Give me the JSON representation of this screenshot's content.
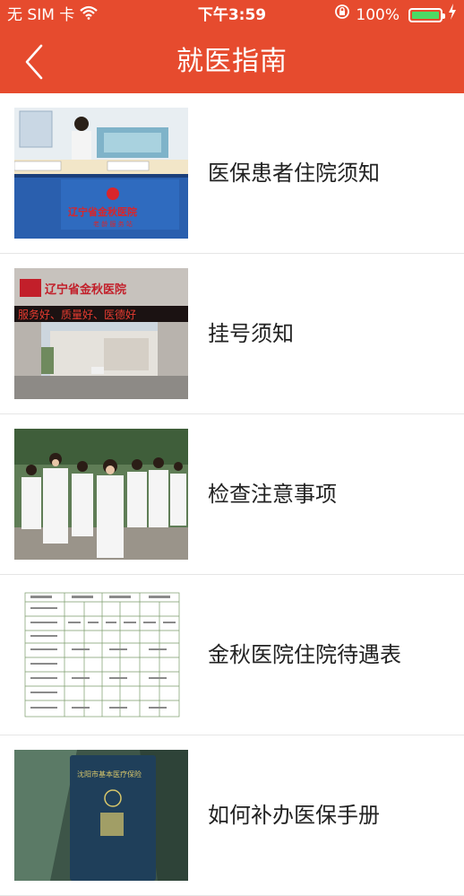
{
  "status_bar": {
    "carrier": "无 SIM 卡",
    "time": "下午3:59",
    "battery": "100%"
  },
  "nav": {
    "title": "就医指南"
  },
  "items": [
    {
      "label": "医保患者住院须知",
      "image_text": "辽宁省金秋医院 老 龄 服 务 站"
    },
    {
      "label": "挂号须知",
      "image_text": "辽宁省金秋医院  服务好、质量好、医德好"
    },
    {
      "label": "检查注意事项"
    },
    {
      "label": "金秋医院住院待遇表"
    },
    {
      "label": "如何补办医保手册",
      "image_text": "沈阳市基本医疗保险"
    }
  ],
  "colors": {
    "header": "#e64b2e",
    "battery_fill": "#4cd964",
    "divider": "#e6e6e6"
  }
}
